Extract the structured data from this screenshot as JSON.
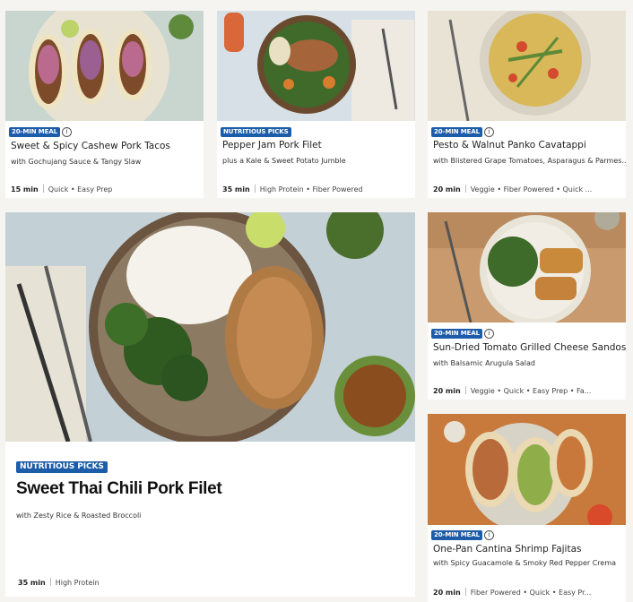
{
  "cards": [
    {
      "badge": "20-MIN MEAL",
      "title": "Sweet & Spicy Cashew Pork Tacos",
      "subtitle": "with Gochujang Sauce & Tangy Slaw",
      "time": "15 min",
      "tags": "Quick • Easy Prep"
    },
    {
      "badge": "NUTRITIOUS PICKS",
      "title": "Pepper Jam Pork Filet",
      "subtitle": "plus a Kale & Sweet Potato Jumble",
      "time": "35 min",
      "tags": "High Protein • Fiber Powered"
    },
    {
      "badge": "20-MIN MEAL",
      "title": "Pesto & Walnut Panko Cavatappi",
      "subtitle": "with Blistered Grape Tomatoes, Asparagus & Parmes...",
      "time": "20 min",
      "tags": "Veggie • Fiber Powered • Quick ..."
    },
    {
      "badge": "NUTRITIOUS PICKS",
      "title": "Sweet Thai Chili Pork Filet",
      "subtitle": "with Zesty Rice & Roasted Broccoli",
      "time": "35 min",
      "tags": "High Protein"
    },
    {
      "badge": "20-MIN MEAL",
      "title": "Sun-Dried Tomato Grilled Cheese Sandos",
      "subtitle": "with Balsamic Arugula Salad",
      "time": "20 min",
      "tags": "Veggie • Quick • Easy Prep • Fa..."
    },
    {
      "badge": "20-MIN MEAL",
      "title": "One-Pan Cantina Shrimp Fajitas",
      "subtitle": "with Spicy Guacamole & Smoky Red Pepper Crema",
      "time": "20 min",
      "tags": "Fiber Powered • Quick • Easy Pr..."
    }
  ],
  "info_icon": "i",
  "colors": {
    "badge": "#1c5ca8",
    "page_bg": "#f6f4f0"
  }
}
